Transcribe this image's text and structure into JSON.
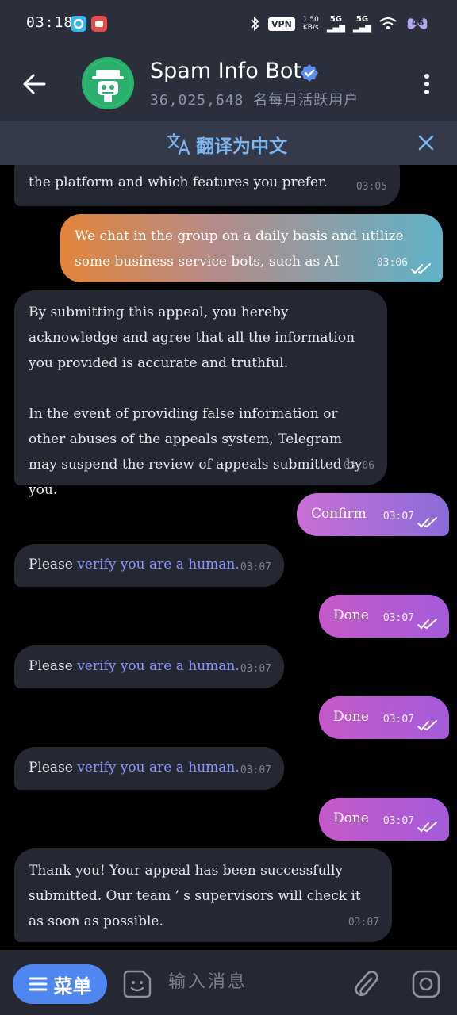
{
  "status_bar": {
    "time": "03:18",
    "vpn": "VPN",
    "speed_value": "1.50",
    "speed_unit": "KB/s",
    "net1": "5G",
    "net2": "5G",
    "battery": "46"
  },
  "header": {
    "title": "Spam Info Bot",
    "subtitle": "36,025,648 名每月活跃用户"
  },
  "translate_bar": {
    "label": "翻译为中文"
  },
  "messages": [
    {
      "direction": "in",
      "text": "the platform and which features you prefer.",
      "time": "03:05"
    },
    {
      "direction": "out",
      "text": "We chat in the group on a daily basis and utilize some business service bots, such as AI",
      "time": "03:06"
    },
    {
      "direction": "in",
      "p1": "By submitting this appeal, you hereby acknowledge and agree that all the information you provided is accurate and truthful.",
      "p2": "In the event of providing false information or other abuses of the appeals system, Telegram may suspend the review of appeals submitted by you.",
      "time": "03:06"
    },
    {
      "direction": "out",
      "text": "Confirm",
      "time": "03:07"
    },
    {
      "direction": "in",
      "prefix": "Please",
      "link": "verify you are a human.",
      "time": "03:07"
    },
    {
      "direction": "out",
      "text": "Done",
      "time": "03:07"
    },
    {
      "direction": "in",
      "prefix": "Please",
      "link": "verify you are a human.",
      "time": "03:07"
    },
    {
      "direction": "out",
      "text": "Done",
      "time": "03:07"
    },
    {
      "direction": "in",
      "prefix": "Please",
      "link": "verify you are a human.",
      "time": "03:07"
    },
    {
      "direction": "out",
      "text": "Done",
      "time": "03:07"
    },
    {
      "direction": "in",
      "text": "Thank you! Your appeal has been successfully submitted. Our team ’ s supervisors will check it as soon as possible.",
      "time": "03:07"
    }
  ],
  "composer": {
    "menu_label": "菜单",
    "placeholder": "输入消息"
  },
  "colors": {
    "header_bg": "#2b2f3b",
    "incoming_bubble": "#252732",
    "link": "#8c95ff",
    "menu_button": "#4f86ef",
    "translate_label": "#7fb5ee"
  },
  "icons": [
    "back-arrow-icon",
    "bot-avatar-icon",
    "verified-badge-icon",
    "more-vertical-icon",
    "translate-icon",
    "close-icon",
    "menu-lines-icon",
    "sticker-icon",
    "attach-icon",
    "camera-icon",
    "double-check-icon"
  ]
}
